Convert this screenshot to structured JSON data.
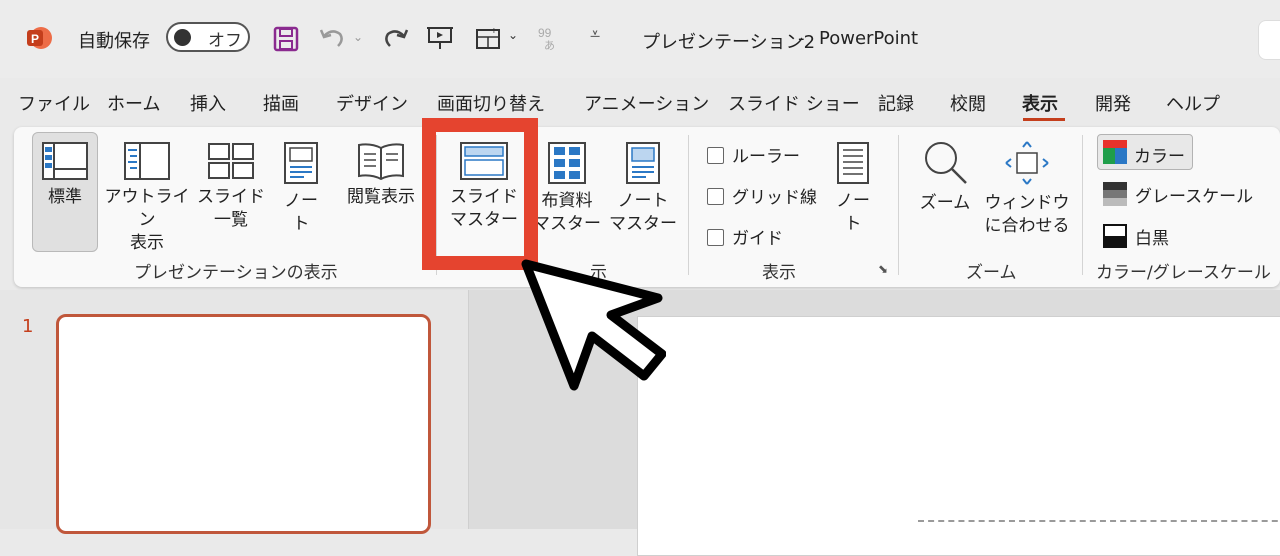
{
  "titlebar": {
    "autosave_label": "自動保存",
    "autosave_state": "オフ",
    "document_title": "プレゼンテーション2",
    "separator": "-",
    "app_name": "PowerPoint"
  },
  "tabs": [
    {
      "label": "ファイル"
    },
    {
      "label": "ホーム"
    },
    {
      "label": "挿入"
    },
    {
      "label": "描画"
    },
    {
      "label": "デザイン"
    },
    {
      "label": "画面切り替え"
    },
    {
      "label": "アニメーション"
    },
    {
      "label": "スライド ショー"
    },
    {
      "label": "記録"
    },
    {
      "label": "校閲"
    },
    {
      "label": "表示"
    },
    {
      "label": "開発"
    },
    {
      "label": "ヘルプ"
    }
  ],
  "active_tab": "表示",
  "ribbon": {
    "presentation_views": {
      "label": "プレゼンテーションの表示",
      "normal": "標準",
      "outline_1": "アウトライン",
      "outline_2": "表示",
      "sorter_1": "スライド",
      "sorter_2": "一覧",
      "notes_1": "ノー",
      "notes_2": "ト",
      "reading": "閲覧表示"
    },
    "master_views": {
      "label": "表示",
      "label_visible": "示",
      "slide_master_1": "スライド",
      "slide_master_2": "マスター",
      "handout_master_1": "布資料",
      "handout_master_2": "マスター",
      "notes_master_1": "ノート",
      "notes_master_2": "マスター"
    },
    "show": {
      "label": "表示",
      "ruler": "ルーラー",
      "gridlines": "グリッド線",
      "guides": "ガイド",
      "notes_1": "ノー",
      "notes_2": "ト"
    },
    "zoom": {
      "label": "ズーム",
      "zoom": "ズーム",
      "fit_1": "ウィンドウ",
      "fit_2": "に合わせる"
    },
    "color": {
      "label": "カラー/グレースケール",
      "color": "カラー",
      "grayscale": "グレースケール",
      "bw": "白黒"
    }
  },
  "slides": [
    {
      "number": "1"
    }
  ],
  "colors": {
    "accent": "#c43e1c",
    "highlight_box": "#e5442f"
  }
}
